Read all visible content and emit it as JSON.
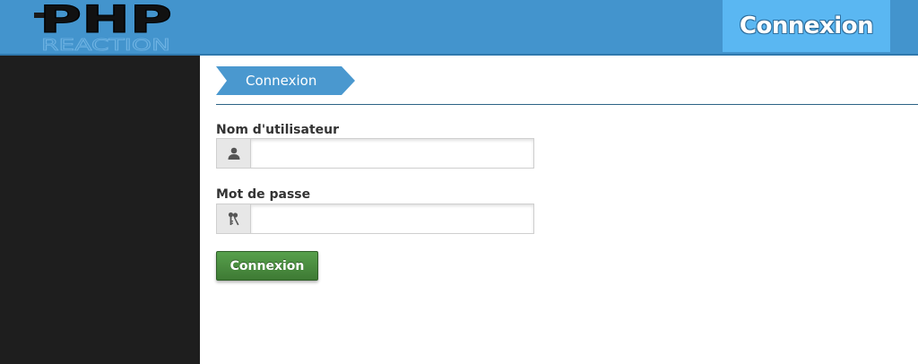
{
  "header": {
    "logo": {
      "line1": "PHP",
      "line2": "REACTION"
    },
    "title": "Connexion"
  },
  "breadcrumb": {
    "label": "Connexion"
  },
  "form": {
    "username": {
      "label": "Nom d'utilisateur",
      "value": "",
      "icon": "user-icon"
    },
    "password": {
      "label": "Mot de passe",
      "value": "",
      "icon": "keys-icon"
    },
    "submit_label": "Connexion"
  },
  "colors": {
    "header_bg": "#4394cd",
    "header_title_bg": "#5ab7f2",
    "sidebar_bg": "#1e1e1e",
    "breadcrumb_bg": "#4a98cf",
    "submit_bg": "#4a8c40"
  }
}
